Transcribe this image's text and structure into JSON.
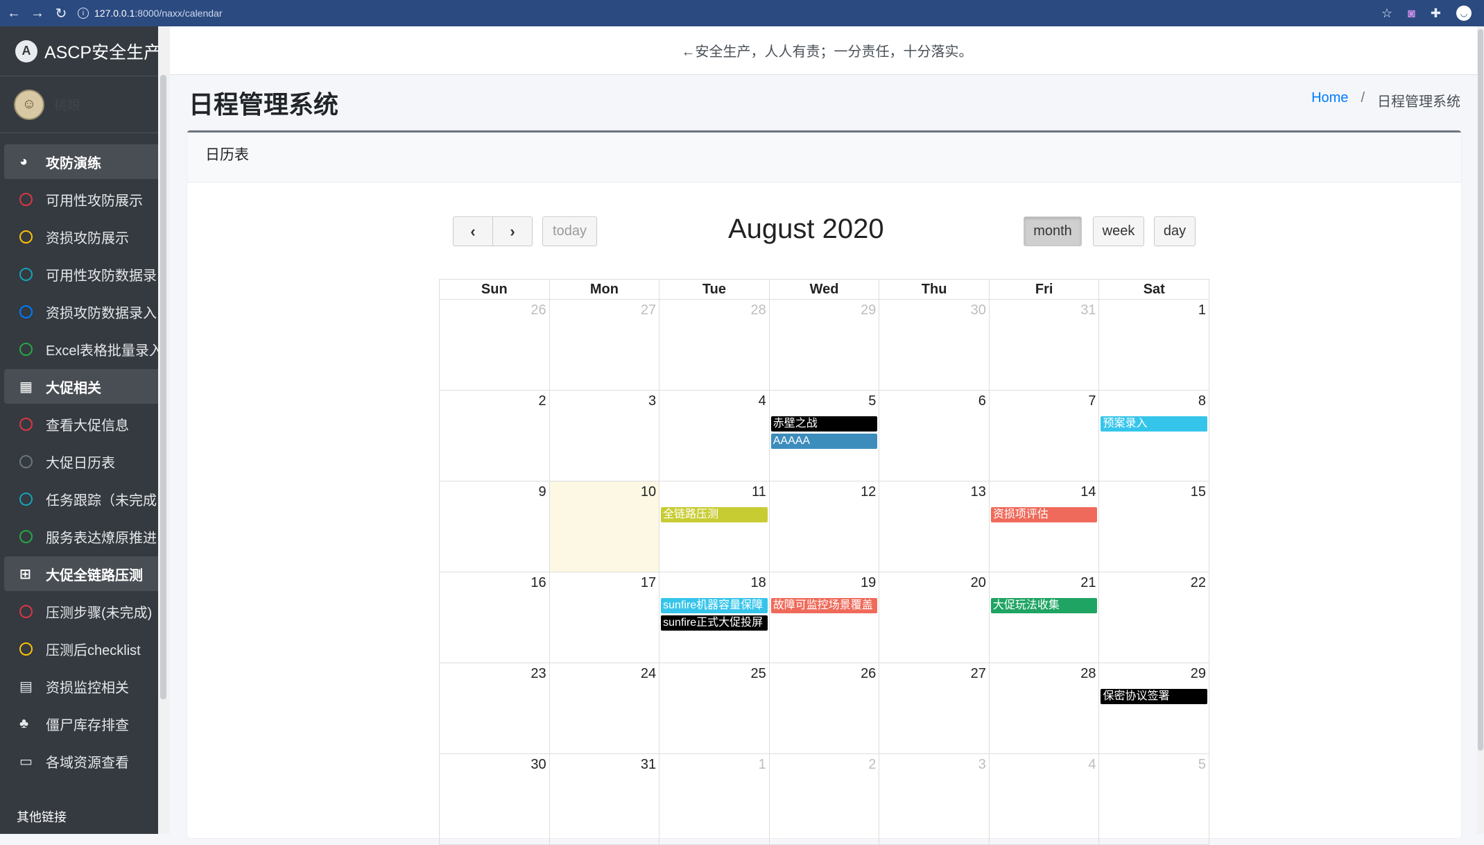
{
  "browser": {
    "url_host": "127.0.0.1",
    "url_path": ":8000/naxx/calendar"
  },
  "sidebar": {
    "brand": "ASCP安全生产",
    "brand_logo": "A",
    "user_name": "桃眼",
    "items": [
      {
        "label": "攻防演练",
        "type": "group",
        "icon": "dashboard-icon",
        "glyph": "◕"
      },
      {
        "label": "可用性攻防展示",
        "type": "item",
        "ring": "#dc3545"
      },
      {
        "label": "资损攻防展示",
        "type": "item",
        "ring": "#ffc107"
      },
      {
        "label": "可用性攻防数据录",
        "type": "item",
        "ring": "#17a2b8"
      },
      {
        "label": "资损攻防数据录入",
        "type": "item",
        "ring": "#007bff"
      },
      {
        "label": "Excel表格批量录入",
        "type": "item",
        "ring": "#28a745"
      },
      {
        "label": "大促相关",
        "type": "group",
        "icon": "grid-icon",
        "glyph": "▦"
      },
      {
        "label": "查看大促信息",
        "type": "item",
        "ring": "#dc3545"
      },
      {
        "label": "大促日历表",
        "type": "item",
        "ring": "#6c757d"
      },
      {
        "label": "任务跟踪（未完成",
        "type": "item",
        "ring": "#17a2b8"
      },
      {
        "label": "服务表达燎原推进",
        "type": "item",
        "ring": "#28a745"
      },
      {
        "label": "大促全链路压测",
        "type": "group",
        "icon": "plus-square-icon",
        "glyph": "⊞"
      },
      {
        "label": "压测步骤(未完成)",
        "type": "item",
        "ring": "#dc3545"
      },
      {
        "label": "压测后checklist",
        "type": "item",
        "ring": "#ffc107"
      },
      {
        "label": "资损监控相关",
        "type": "item",
        "icon": "book-icon",
        "glyph": "▤"
      },
      {
        "label": "僵尸库存排查",
        "type": "item",
        "icon": "tree-icon",
        "glyph": "♣"
      },
      {
        "label": "各域资源查看",
        "type": "item",
        "icon": "hdd-icon",
        "glyph": "▭"
      }
    ],
    "footer": "其他链接"
  },
  "topnav": {
    "slogan": "←安全生产，人人有责；一分责任，十分落实。"
  },
  "page": {
    "title": "日程管理系统",
    "breadcrumb_home": "Home",
    "breadcrumb_sep": "/",
    "breadcrumb_current": "日程管理系统"
  },
  "card": {
    "header": "日历表"
  },
  "calendar": {
    "title": "August 2020",
    "prev_icon": "chevron-left-icon",
    "next_icon": "chevron-right-icon",
    "today_label": "today",
    "view_month": "month",
    "view_week": "week",
    "view_day": "day",
    "active_view": "month",
    "weekdays": [
      "Sun",
      "Mon",
      "Tue",
      "Wed",
      "Thu",
      "Fri",
      "Sat"
    ],
    "weeks": [
      [
        {
          "d": "26",
          "o": true
        },
        {
          "d": "27",
          "o": true
        },
        {
          "d": "28",
          "o": true
        },
        {
          "d": "29",
          "o": true
        },
        {
          "d": "30",
          "o": true
        },
        {
          "d": "31",
          "o": true
        },
        {
          "d": "1"
        }
      ],
      [
        {
          "d": "2"
        },
        {
          "d": "3"
        },
        {
          "d": "4"
        },
        {
          "d": "5",
          "ev": [
            {
              "t": "赤壁之战",
              "c": "#000000"
            },
            {
              "t": "AAAAA",
              "c": "#3c8dbc"
            }
          ]
        },
        {
          "d": "6"
        },
        {
          "d": "7"
        },
        {
          "d": "8",
          "ev": [
            {
              "t": "预案录入",
              "c": "#36c5ea"
            }
          ]
        }
      ],
      [
        {
          "d": "9"
        },
        {
          "d": "10",
          "today": true
        },
        {
          "d": "11",
          "ev": [
            {
              "t": "全链路压测",
              "c": "#c8cc33"
            }
          ]
        },
        {
          "d": "12"
        },
        {
          "d": "13"
        },
        {
          "d": "14",
          "ev": [
            {
              "t": "资损项评估",
              "c": "#ef6a5a"
            }
          ]
        },
        {
          "d": "15"
        }
      ],
      [
        {
          "d": "16"
        },
        {
          "d": "17"
        },
        {
          "d": "18",
          "ev": [
            {
              "t": "sunfire机器容量保障",
              "c": "#36c5ea"
            },
            {
              "t": "sunfire正式大促投屏",
              "c": "#000000"
            }
          ]
        },
        {
          "d": "19",
          "ev": [
            {
              "t": "故障可监控场景覆盖",
              "c": "#ef6a5a"
            }
          ]
        },
        {
          "d": "20"
        },
        {
          "d": "21",
          "ev": [
            {
              "t": "大促玩法收集",
              "c": "#1fa463"
            }
          ]
        },
        {
          "d": "22"
        }
      ],
      [
        {
          "d": "23"
        },
        {
          "d": "24"
        },
        {
          "d": "25"
        },
        {
          "d": "26"
        },
        {
          "d": "27"
        },
        {
          "d": "28"
        },
        {
          "d": "29",
          "ev": [
            {
              "t": "保密协议签署",
              "c": "#000000"
            }
          ]
        }
      ],
      [
        {
          "d": "30"
        },
        {
          "d": "31"
        },
        {
          "d": "1",
          "o": true
        },
        {
          "d": "2",
          "o": true
        },
        {
          "d": "3",
          "o": true
        },
        {
          "d": "4",
          "o": true
        },
        {
          "d": "5",
          "o": true
        }
      ]
    ]
  }
}
